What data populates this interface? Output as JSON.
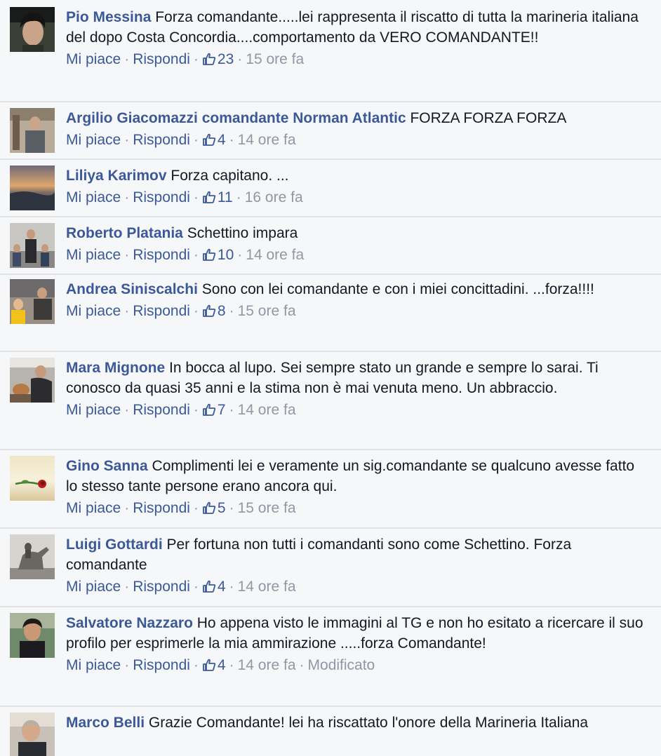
{
  "labels": {
    "like": "Mi piace",
    "reply": "Rispondi",
    "separator": "·"
  },
  "comments": [
    {
      "author": "Pio Messina",
      "text": "Forza comandante.....lei rappresenta il riscatto di tutta la marineria italiana del dopo Costa Concordia....comportamento da VERO COMANDANTE!!",
      "likes": "23",
      "time": "15 ore fa",
      "edited": ""
    },
    {
      "author": "Argilio Giacomazzi comandante Norman Atlantic",
      "text": "FORZA FORZA FORZA",
      "likes": "4",
      "time": "14 ore fa",
      "edited": ""
    },
    {
      "author": "Liliya Karimov",
      "text": "Forza capitano. ...",
      "likes": "11",
      "time": "16 ore fa",
      "edited": ""
    },
    {
      "author": "Roberto Platania",
      "text": "Schettino impara",
      "likes": "10",
      "time": "14 ore fa",
      "edited": ""
    },
    {
      "author": "Andrea Siniscalchi",
      "text": "Sono con lei comandante e con i miei concittadini. ...forza!!!!",
      "likes": "8",
      "time": "15 ore fa",
      "edited": ""
    },
    {
      "author": "Mara Mignone",
      "text": "In bocca al lupo. Sei sempre stato un grande e sempre lo sarai. Ti conosco da quasi 35 anni e la stima non è mai venuta meno. Un abbraccio.",
      "likes": "7",
      "time": "14 ore fa",
      "edited": ""
    },
    {
      "author": "Gino Sanna",
      "text": "Complimenti lei e veramente un sig.comandante se qualcuno avesse fatto lo stesso tante persone erano ancora qui.",
      "likes": "5",
      "time": "15 ore fa",
      "edited": ""
    },
    {
      "author": "Luigi Gottardi",
      "text": "Per fortuna non tutti i comandanti sono come Schettino. Forza comandante",
      "likes": "4",
      "time": "14 ore fa",
      "edited": ""
    },
    {
      "author": "Salvatore Nazzaro",
      "text": "Ho appena visto le immagini al TG e non ho esitato a ricercare il suo profilo per esprimerle la mia ammirazione .....forza Comandante!",
      "likes": "4",
      "time": "14 ore fa",
      "edited": "Modificato"
    },
    {
      "author": "Marco Belli",
      "text": "Grazie Comandante! lei ha riscattato l'onore della Marineria Italiana",
      "likes": "",
      "time": "",
      "edited": ""
    }
  ]
}
